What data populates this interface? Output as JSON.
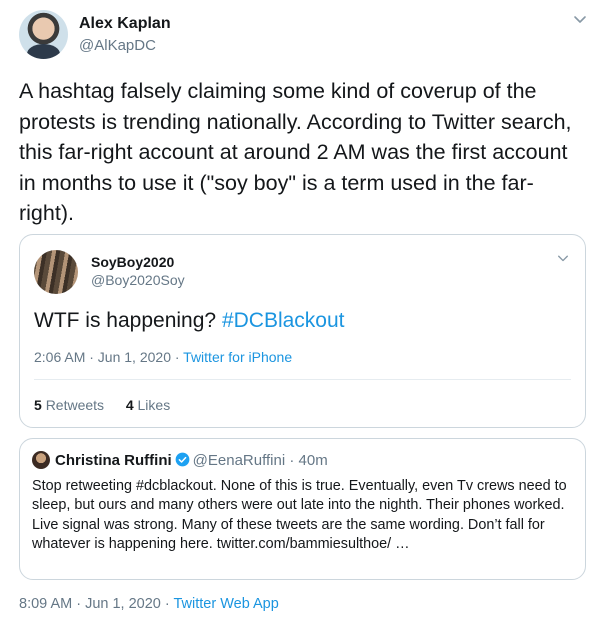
{
  "author": {
    "name": "Alex Kaplan",
    "handle": "@AlKapDC"
  },
  "tweet_text": "A hashtag falsely claiming some kind of coverup of the protests is trending nationally. According to Twitter search, this far-right account at around 2 AM was the first account in months to use it (\"soy boy\" is a term used in the far-right).",
  "quoted": {
    "name": "SoyBoy2020",
    "handle": "@Boy2020Soy",
    "text_plain": "WTF is happening? ",
    "text_tag": "#DCBlackout",
    "time": "2:06 AM · Jun 1, 2020 · ",
    "source": "Twitter for iPhone",
    "retweets_count": "5",
    "retweets_label": "Retweets",
    "likes_count": "4",
    "likes_label": "Likes"
  },
  "quoted2": {
    "name": "Christina Ruffini",
    "handle": "@EenaRuffini · 40m",
    "text": "Stop retweeting #dcblackout. None of this is true. Eventually, even Tv crews need to sleep, but ours and many others were out late into the nighth. Their phones worked. Live signal was strong. Many of these tweets are the same wording. Don’t fall for whatever is happening here. twitter.com/bammiesulthoe/ …"
  },
  "footer": {
    "time": "8:09 AM · Jun 1, 2020 · ",
    "source": "Twitter Web App"
  },
  "icons": {
    "menu": "chevron-down-icon",
    "verified": "verified-badge-icon"
  },
  "colors": {
    "link": "#1b95e0",
    "muted": "#657786",
    "text": "#14171a",
    "border": "#ccd6dd"
  }
}
